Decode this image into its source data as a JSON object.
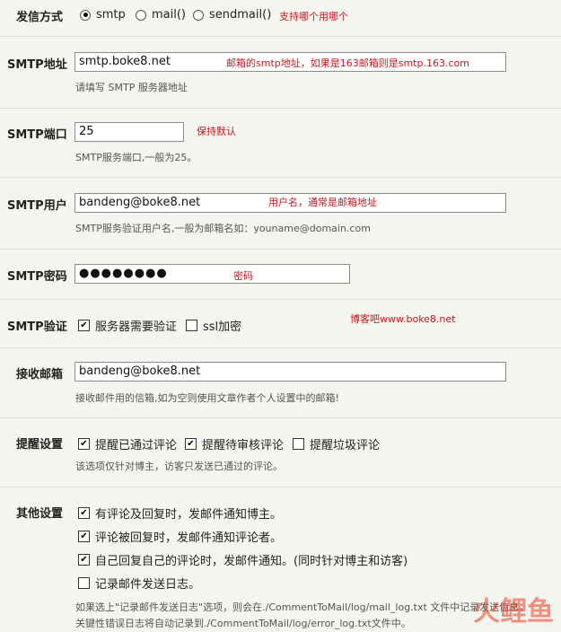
{
  "send_method": {
    "label": "发信方式",
    "options": [
      "smtp",
      "mail()",
      "sendmail()"
    ],
    "selected": "smtp",
    "note": "支持哪个用哪个"
  },
  "smtp_host": {
    "label": "SMTP地址",
    "value": "smtp.boke8.net",
    "note": "邮箱的smtp地址，如果是163邮箱则是smtp.163.com",
    "help": "请填写 SMTP 服务器地址"
  },
  "smtp_port": {
    "label": "SMTP端口",
    "value": "25",
    "note": "保持默认",
    "help": "SMTP服务端口,一般为25。"
  },
  "smtp_user": {
    "label": "SMTP用户",
    "value": "bandeng@boke8.net",
    "note": "用户名，通常是邮箱地址",
    "help": "SMTP服务验证用户名,一般为邮箱名如：youname@domain.com"
  },
  "smtp_password": {
    "label": "SMTP密码",
    "value": "●●●●●●●●",
    "note": "密码"
  },
  "smtp_auth": {
    "label": "SMTP验证",
    "auth_label": "服务器需要验证",
    "auth_checked": true,
    "ssl_label": "ssl加密",
    "ssl_checked": false,
    "note": "博客吧www.boke8.net"
  },
  "recv_email": {
    "label": "接收邮箱",
    "value": "bandeng@boke8.net",
    "help": "接收邮件用的信箱,如为空则使用文章作者个人设置中的邮箱!"
  },
  "remind": {
    "label": "提醒设置",
    "items": [
      {
        "label": "提醒已通过评论",
        "checked": true
      },
      {
        "label": "提醒待审核评论",
        "checked": true
      },
      {
        "label": "提醒垃圾评论",
        "checked": false
      }
    ],
    "help": "该选项仅针对博主，访客只发送已通过的评论。"
  },
  "other": {
    "label": "其他设置",
    "items": [
      {
        "label": "有评论及回复时，发邮件通知博主。",
        "checked": true
      },
      {
        "label": "评论被回复时，发邮件通知评论者。",
        "checked": true
      },
      {
        "label": "自己回复自己的评论时，发邮件通知。(同时针对博主和访客)",
        "checked": true
      },
      {
        "label": "记录邮件发送日志。",
        "checked": false
      }
    ],
    "help1": "如果选上\"记录邮件发送日志\"选项，则会在./CommentToMail/log/mail_log.txt 文件中记录发送信息。",
    "help2": "关键性错误日志将自动记录到./CommentToMail/log/error_log.txt文件中。"
  },
  "watermark": "火鲤鱼",
  "colors": {
    "background": "#f4f5ef",
    "note_red": "#c8161d",
    "divider": "#dfe3d4"
  }
}
